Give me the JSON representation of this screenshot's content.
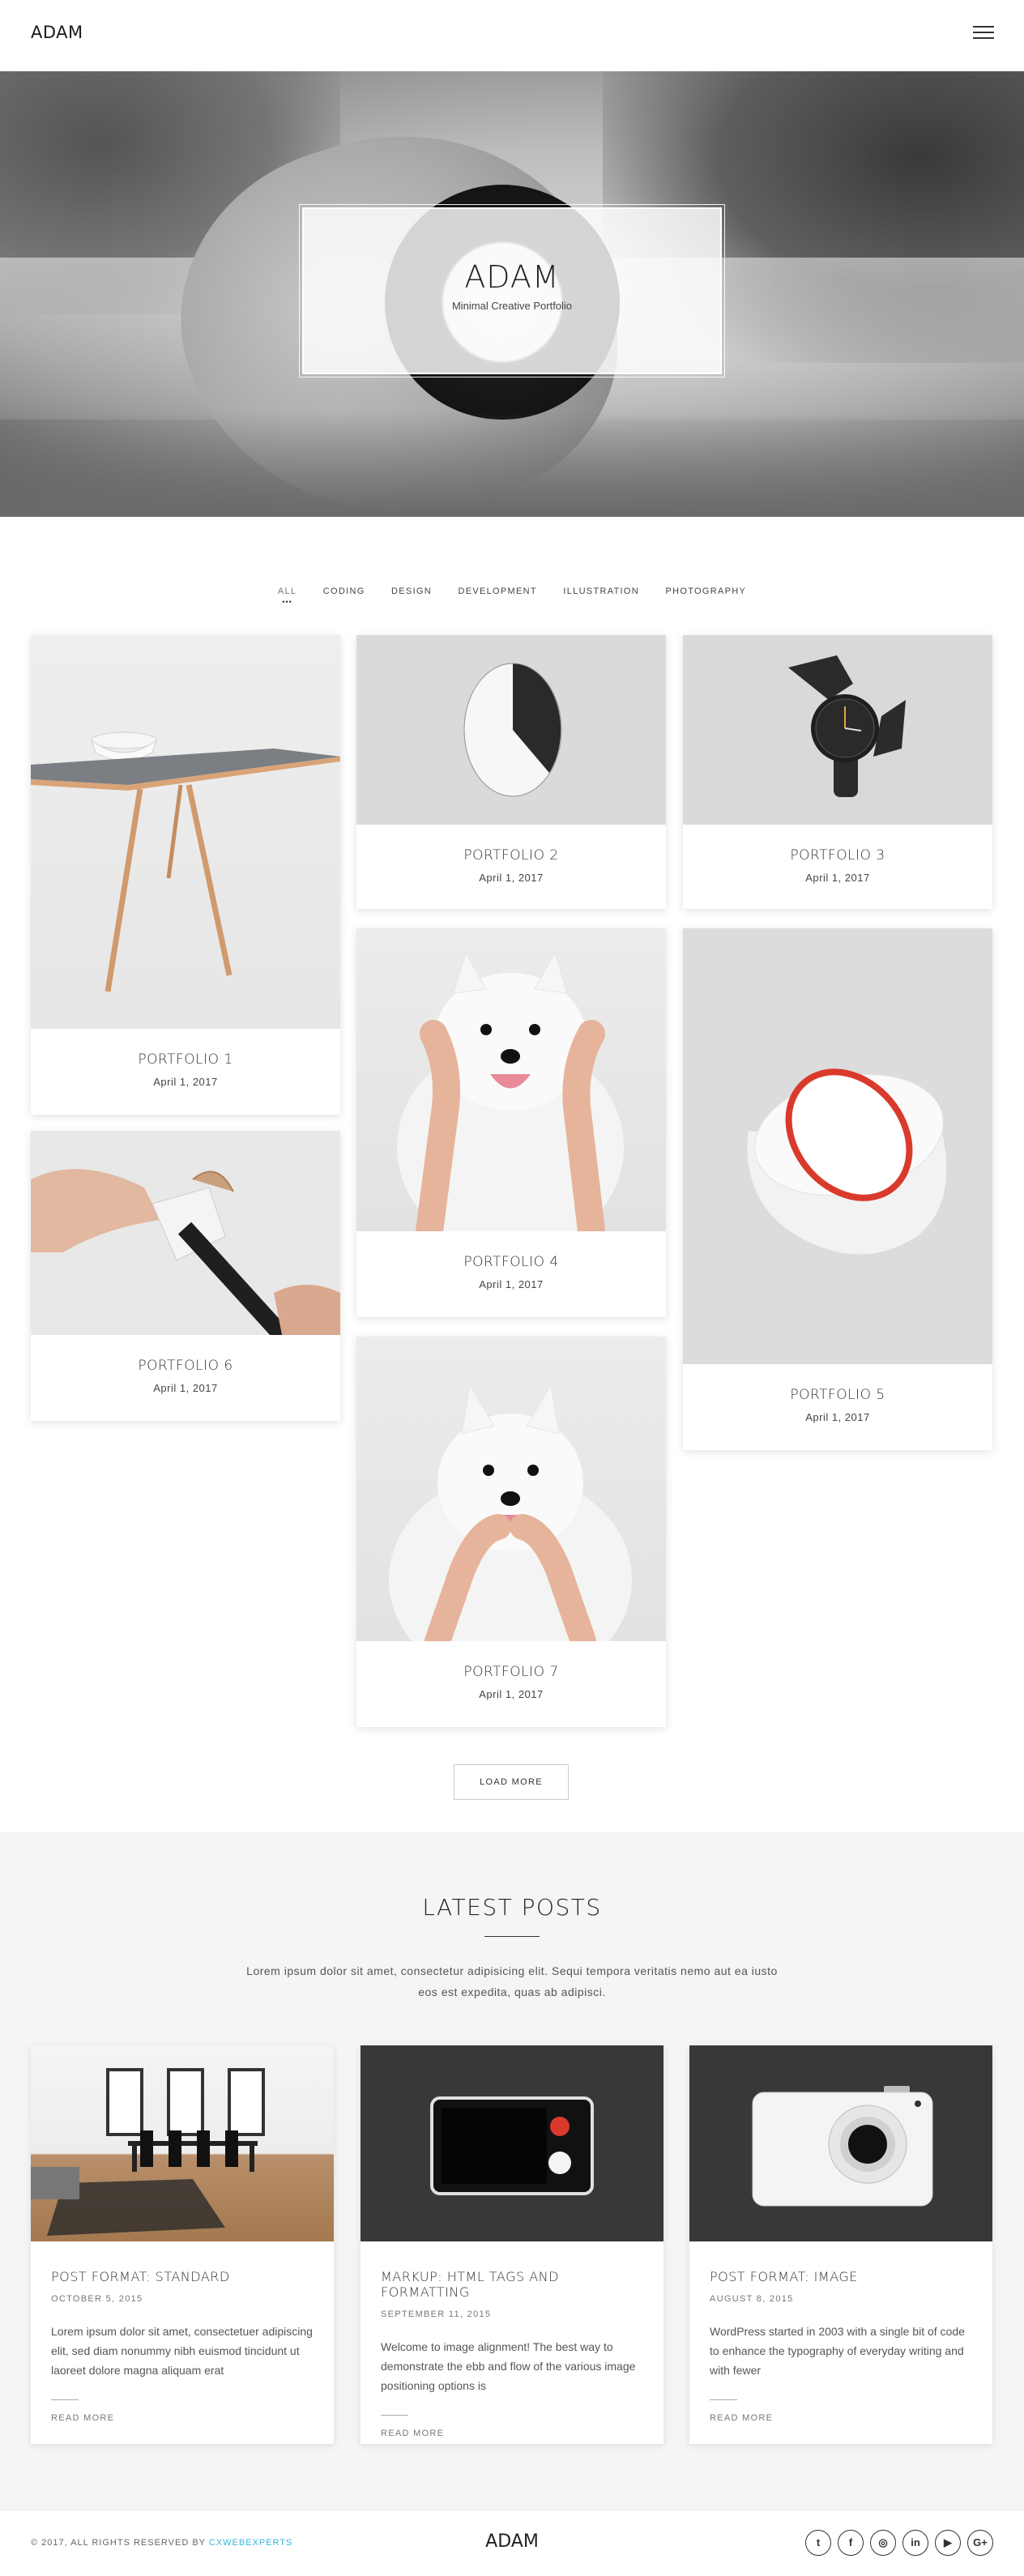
{
  "header": {
    "logo": "ADAM",
    "menu_icon": "hamburger-icon"
  },
  "hero": {
    "title": "ADAM",
    "subtitle": "Minimal Creative Portfolio"
  },
  "filters": {
    "items": [
      "ALL",
      "CODING",
      "DESIGN",
      "DEVELOPMENT",
      "ILLUSTRATION",
      "PHOTOGRAPHY"
    ],
    "active": "ALL"
  },
  "portfolio": {
    "items": [
      {
        "title": "PORTFOLIO 1",
        "date": "April 1, 2017"
      },
      {
        "title": "PORTFOLIO 2",
        "date": "April 1, 2017"
      },
      {
        "title": "PORTFOLIO 3",
        "date": "April 1, 2017"
      },
      {
        "title": "PORTFOLIO 4",
        "date": "April 1, 2017"
      },
      {
        "title": "PORTFOLIO 5",
        "date": "April 1, 2017"
      },
      {
        "title": "PORTFOLIO 6",
        "date": "April 1, 2017"
      },
      {
        "title": "PORTFOLIO 7",
        "date": "April 1, 2017"
      }
    ],
    "load_more": "LOAD MORE"
  },
  "latest": {
    "title": "LATEST POSTS",
    "description": "Lorem ipsum dolor sit amet, consectetur adipisicing elit. Sequi tempora veritatis nemo aut ea iusto eos est expedita, quas ab adipisci.",
    "posts": [
      {
        "title": "POST FORMAT: STANDARD",
        "date": "OCTOBER 5, 2015",
        "excerpt": "Lorem ipsum dolor sit amet, consectetuer adipiscing elit, sed diam nonummy nibh euismod tincidunt ut laoreet dolore magna aliquam erat",
        "more": "READ MORE"
      },
      {
        "title": "MARKUP: HTML TAGS AND FORMATTING",
        "date": "SEPTEMBER 11, 2015",
        "excerpt": "Welcome to image alignment! The best way to demonstrate the ebb and flow of the various image positioning options is",
        "more": "READ MORE"
      },
      {
        "title": "POST FORMAT: IMAGE",
        "date": "AUGUST 8, 2015",
        "excerpt": "WordPress started in 2003 with a single bit of code to enhance the typography of everyday writing and with fewer",
        "more": "READ MORE"
      }
    ]
  },
  "footer": {
    "copyright_prefix": "© 2017, ALL RIGHTS RESERVED BY ",
    "copyright_link": "CXWEBEXPERTS",
    "logo": "ADAM",
    "socials": [
      {
        "icon": "twitter-icon",
        "glyph": "t"
      },
      {
        "icon": "facebook-icon",
        "glyph": "f"
      },
      {
        "icon": "instagram-icon",
        "glyph": "◎"
      },
      {
        "icon": "linkedin-icon",
        "glyph": "in"
      },
      {
        "icon": "youtube-icon",
        "glyph": "▶"
      },
      {
        "icon": "google-plus-icon",
        "glyph": "G+"
      }
    ]
  },
  "colors": {
    "accent_link": "#38b6d8",
    "text": "#333333",
    "section_bg": "#f5f5f5"
  }
}
